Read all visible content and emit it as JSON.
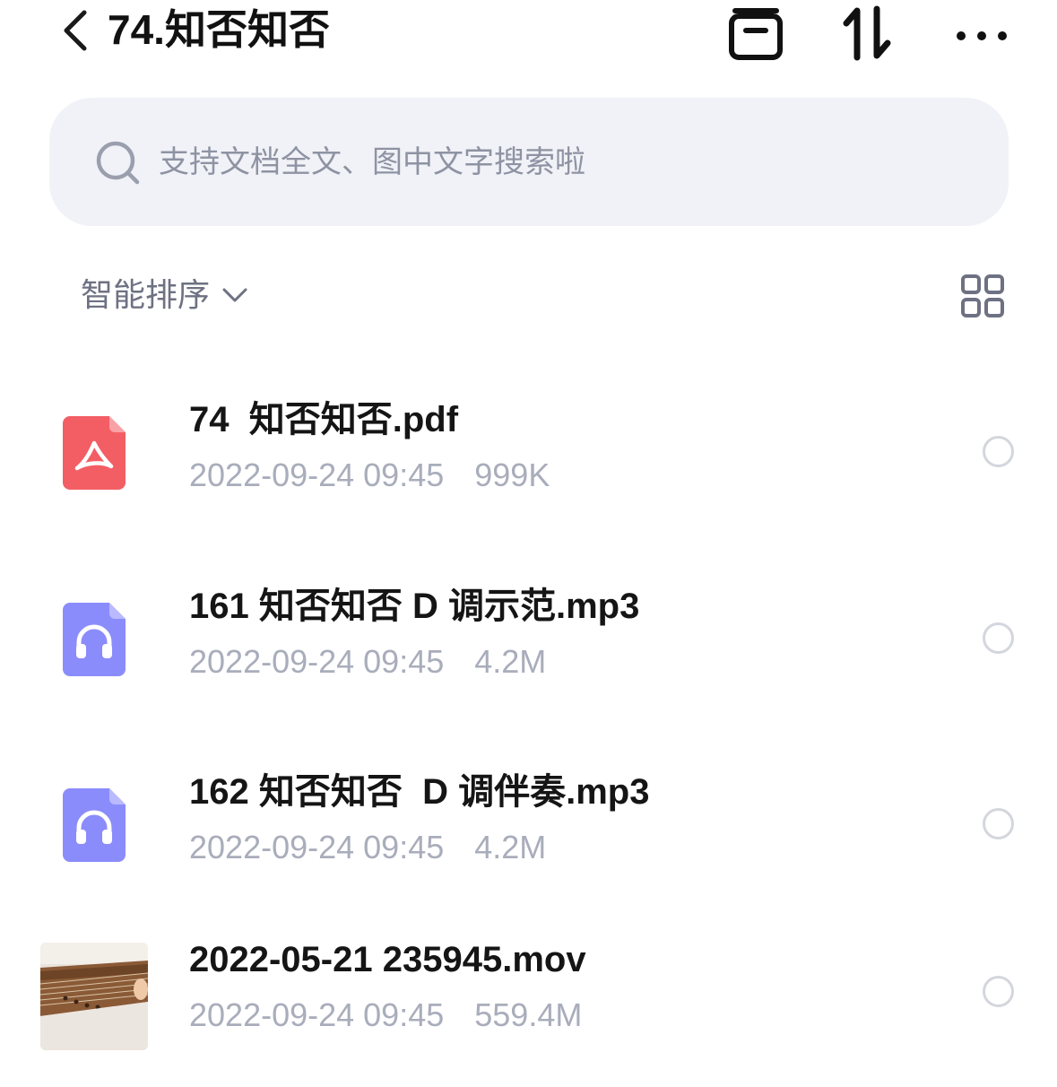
{
  "header": {
    "title": "74.知否知否"
  },
  "search": {
    "placeholder": "支持文档全文、图中文字搜索啦"
  },
  "toolbar": {
    "sort_label": "智能排序"
  },
  "files": [
    {
      "name": "74  知否知否.pdf",
      "date": "2022-09-24 09:45",
      "size": "999K",
      "type": "pdf-icon"
    },
    {
      "name": "161 知否知否 D 调示范.mp3",
      "date": "2022-09-24 09:45",
      "size": "4.2M",
      "type": "audio-icon"
    },
    {
      "name": "162 知否知否  D 调伴奏.mp3",
      "date": "2022-09-24 09:45",
      "size": "4.2M",
      "type": "audio-icon"
    },
    {
      "name": "2022-05-21 235945.mov",
      "date": "2022-09-24 09:45",
      "size": "559.4M",
      "type": "video-thumbnail"
    }
  ],
  "colors": {
    "pdf": "#f25e64",
    "audio": "#8b8cfb",
    "meta_text": "#a9adbb",
    "search_bg": "#f1f2f7"
  }
}
